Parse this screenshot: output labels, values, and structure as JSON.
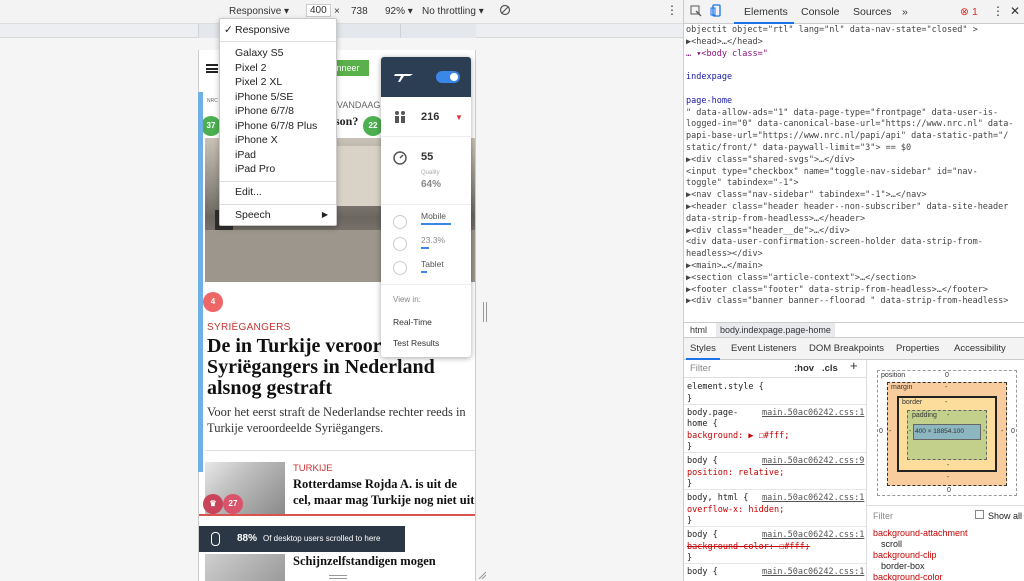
{
  "device_toolbar": {
    "mode": "Responsive ▾",
    "width": "400",
    "times": "×",
    "height": "738",
    "zoom": "92% ▾",
    "throttle": "No throttling ▾"
  },
  "device_menu": {
    "selected": "Responsive",
    "devices": [
      "Galaxy S5",
      "Pixel 2",
      "Pixel 2 XL",
      "iPhone 5/SE",
      "iPhone 6/7/8",
      "iPhone 6/7/8 Plus",
      "iPhone X",
      "iPad",
      "iPad Pro"
    ],
    "edit": "Edit...",
    "speech": "Speech"
  },
  "webpage": {
    "abonneer": "nneer",
    "wandaag": "VANDAAG",
    "person": "son?",
    "badge_left": "37",
    "badge_right": "22",
    "badge_hero": "4",
    "category": "SYRIËGANGERS",
    "title": "De in Turkije veroordeelde Syriëgangers in Nederland alsnog gestraft",
    "title_visible": "De in Turkije veroor",
    "title_line2": "Syriëgangers in Nederland",
    "title_line3": "alsnog gestraft",
    "lead": "Voor het eerst straft de Nederlandse rechter reeds in Turkije veroordeelde Syriëgangers.",
    "art2_category": "TURKIJE",
    "art2_title": "Rotterdamse Rojda A. is uit de cel, maar mag Turkije nog niet uit",
    "art2_badge": "27",
    "scroll_pct": "88%",
    "scroll_text": "Of desktop users scrolled to here",
    "art3_title": "Schijnzelfstandigen mogen"
  },
  "extension": {
    "users": "216",
    "score": "55",
    "quality_label": "Quality",
    "quality_value": "64%",
    "mobile_label": "Mobile",
    "mobile_value": "23.3%",
    "tablet_label": "Tablet",
    "view_in": "View in:",
    "realtime": "Real-Time",
    "test_results": "Test Results"
  },
  "devtools": {
    "tabs": [
      "Elements",
      "Console",
      "Sources",
      "»"
    ],
    "error_count": "1",
    "dom_lines": [
      "objectit object=\"rtl\" lang=\"nl\" data-nav-state=\"closed\" >",
      "  ▶<head>…</head>",
      "… ▾<body class=\"",
      "",
      "            indexpage",
      "",
      "            page-home",
      "  \" data-allow-ads=\"1\" data-page-type=\"frontpage\" data-user-is-",
      "  logged-in=\"0\" data-canonical-base-url=\"https://www.nrc.nl\" data-",
      "  papi-base-url=\"https://www.nrc.nl/papi/api\" data-static-path=\"/",
      "  static/front/\" data-paywall-limit=\"3\"> == $0",
      "    ▶<div class=\"shared-svgs\">…</div>",
      "      <input type=\"checkbox\" name=\"toggle-nav-sidebar\" id=\"nav-",
      "      toggle\" tabindex=\"-1\">",
      "    ▶<nav class=\"nav-sidebar\" tabindex=\"-1\">…</nav>",
      "    ▶<header class=\"header header--non-subscriber\" data-site-header",
      "    data-strip-from-headless>…</header>",
      "    ▶<div class=\"header__de\">…</div>",
      "      <div data-user-confirmation-screen-holder data-strip-from-",
      "      headless></div>",
      "    ▶<main>…</main>",
      "    ▶<section class=\"article-context\">…</section>",
      "    ▶<footer class=\"footer\" data-strip-from-headless>…</footer>",
      "    ▶<div class=\"banner banner--floorad \" data-strip-from-headless>"
    ],
    "breadcrumb": [
      "html",
      "body.indexpage.page-home"
    ],
    "subtabs": [
      "Styles",
      "Event Listeners",
      "DOM Breakpoints",
      "Properties",
      "Accessibility"
    ],
    "filter_placeholder": "Filter",
    "hov": ":hov",
    "cls": ".cls",
    "plus": "+",
    "styles_lines": [
      {
        "t": "element.style {",
        "k": "plain"
      },
      {
        "t": "}",
        "k": "plain"
      },
      {
        "t": "body.page-",
        "k": "plain",
        "src": "main.50ac06242.css:1"
      },
      {
        "t": "home {",
        "k": "plain"
      },
      {
        "t": "  background: ▶ ☐#fff;",
        "k": "prop"
      },
      {
        "t": "}",
        "k": "plain"
      },
      {
        "t": "body {",
        "k": "plain",
        "src": "main.50ac06242.css:9"
      },
      {
        "t": "  position: relative;",
        "k": "prop"
      },
      {
        "t": "}",
        "k": "plain"
      },
      {
        "t": "body, html {",
        "k": "plain",
        "src": "main.50ac06242.css:1"
      },
      {
        "t": "  overflow-x: hidden;",
        "k": "prop"
      },
      {
        "t": "}",
        "k": "plain"
      },
      {
        "t": "body {",
        "k": "plain",
        "src": "main.50ac06242.css:1"
      },
      {
        "t": "  background-color: ☐#fff;",
        "k": "strike"
      },
      {
        "t": "}",
        "k": "plain"
      },
      {
        "t": "body {",
        "k": "plain",
        "src": "main.50ac06242.css:1"
      }
    ],
    "box_model": {
      "position": "position",
      "position_val": "0",
      "margin": "margin",
      "border": "border",
      "padding": "padding",
      "content": "400 × 18854.100",
      "dash": "-",
      "zero": "0"
    },
    "computed_filter": "Filter",
    "show_all": "Show all",
    "computed": [
      {
        "prop": "background-attachment",
        "val": "scroll"
      },
      {
        "prop": "background-clip",
        "val": "border-box"
      },
      {
        "prop": "background-color",
        "val": ""
      }
    ]
  },
  "colors": {
    "accent": "#1a73e8",
    "extension_header": "#2c3e54",
    "site_red": "#cc3333",
    "site_green": "#5ab04a"
  }
}
